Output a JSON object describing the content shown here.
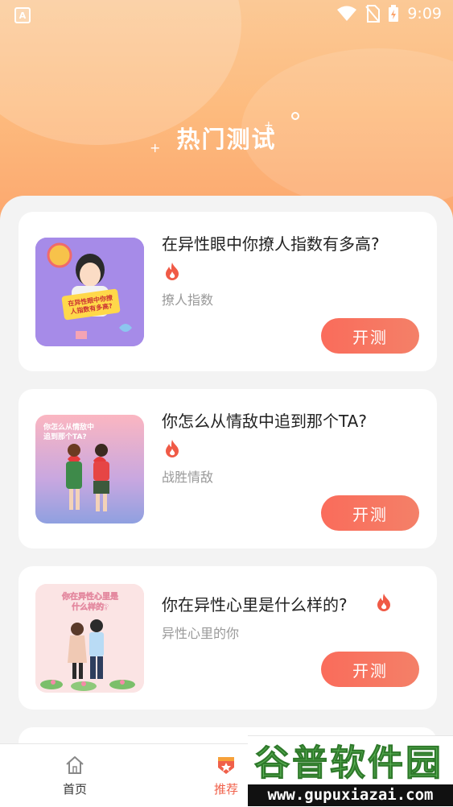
{
  "status": {
    "app_badge": "A",
    "time": "9:09"
  },
  "page": {
    "title": "热门测试"
  },
  "cards": [
    {
      "title": "在异性眼中你撩人指数有多高?",
      "subtitle": "撩人指数",
      "button": "开测"
    },
    {
      "title": "你怎么从情敌中追到那个TA?",
      "subtitle": "战胜情敌",
      "button": "开测"
    },
    {
      "title": "你在异性心里是什么样的?",
      "subtitle": "异性心里的你",
      "button": "开测"
    }
  ],
  "thumbs": [
    {
      "text_line1": "在异性眼中你撩",
      "text_line2": "人指数有多高?"
    },
    {
      "text_line1": "你怎么从情敌中",
      "text_line2": "追到那个TA?"
    },
    {
      "text_line1": "你在异性心里是",
      "text_line2": "什么样的?"
    }
  ],
  "tabs": [
    {
      "label": "首页",
      "icon": "home-icon"
    },
    {
      "label": "推荐",
      "icon": "recommend-badge-icon"
    }
  ],
  "watermark": {
    "brand": "谷普软件园",
    "url": "www.gupuxiazai.com"
  },
  "colors": {
    "accent": "#fa6c5b",
    "header_top": "#fbc996",
    "header_bottom": "#fba46c",
    "tab_active": "#f0604a"
  }
}
